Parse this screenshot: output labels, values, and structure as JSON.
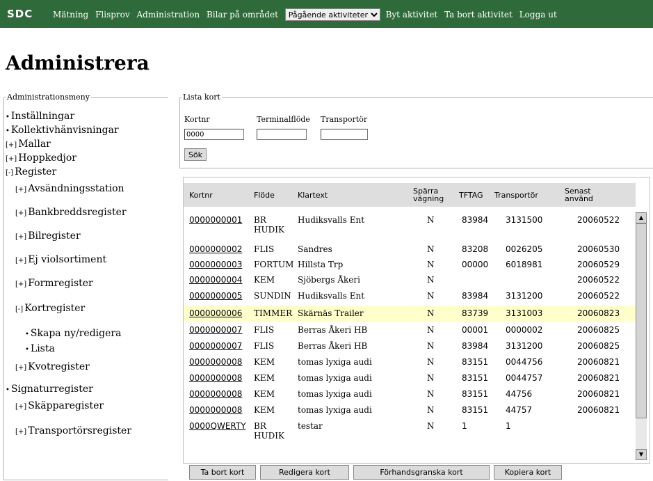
{
  "topbar": {
    "logo": "SDC",
    "nav": [
      "Mätning",
      "Flisprov",
      "Administration",
      "Bilar på området"
    ],
    "activity_select": "Pågående aktiviteter",
    "nav2": [
      "Byt aktivitet",
      "Ta bort aktivitet",
      "Logga ut"
    ]
  },
  "page_title": "Administrera",
  "menu": {
    "legend": "Administrationsmeny",
    "items": [
      {
        "marker": "•",
        "label": "Inställningar"
      },
      {
        "marker": "•",
        "label": "Kollektivhänvisningar"
      },
      {
        "marker": "[+]",
        "label": "Mallar"
      },
      {
        "marker": "[+]",
        "label": "Hoppkedjor"
      },
      {
        "marker": "[-]",
        "label": "Register"
      },
      {
        "marker": "[+]",
        "label": "Avsändningsstation"
      },
      {
        "marker": "[+]",
        "label": "Bankbreddsregister"
      },
      {
        "marker": "[+]",
        "label": "Bilregister"
      },
      {
        "marker": "[+]",
        "label": "Ej violsortiment"
      },
      {
        "marker": "[+]",
        "label": "Formregister"
      },
      {
        "marker": "[-]",
        "label": "Kortregister"
      },
      {
        "marker": "•",
        "label": "Skapa ny/redigera"
      },
      {
        "marker": "•",
        "label": "Lista"
      },
      {
        "marker": "[+]",
        "label": "Kvotregister"
      },
      {
        "marker": "•",
        "label": "Signaturregister"
      },
      {
        "marker": "[+]",
        "label": "Skäpparegister"
      },
      {
        "marker": "[+]",
        "label": "Transportörsregister"
      }
    ]
  },
  "search": {
    "legend": "Lista kort",
    "kortnr_label": "Kortnr",
    "kortnr_value": "0000",
    "terminal_label": "Terminalflöde",
    "terminal_value": "",
    "transportor_label": "Transportör",
    "transportor_value": "",
    "search_button": "Sök"
  },
  "table": {
    "headers": [
      "Kortnr",
      "Flöde",
      "Klartext",
      "Spärra vägning",
      "TFTAG",
      "Transportör",
      "Senast använd"
    ],
    "rows": [
      {
        "kortnr": "0000000001",
        "flode": "BR HUDIK",
        "klartext": "Hudiksvalls Ent",
        "sparra": "N",
        "tftag": "83984",
        "transportor": "3131500",
        "senast": "20060522"
      },
      {
        "kortnr": "0000000002",
        "flode": "FLIS",
        "klartext": "Sandres",
        "sparra": "N",
        "tftag": "83208",
        "transportor": "0026205",
        "senast": "20060530"
      },
      {
        "kortnr": "0000000003",
        "flode": "FORTUM",
        "klartext": "Hillsta Trp",
        "sparra": "N",
        "tftag": "00000",
        "transportor": "6018981",
        "senast": "20060529"
      },
      {
        "kortnr": "0000000004",
        "flode": "KEM",
        "klartext": "Sjöbergs Åkeri",
        "sparra": "N",
        "tftag": "",
        "transportor": "",
        "senast": "20060522"
      },
      {
        "kortnr": "0000000005",
        "flode": "SUNDIN",
        "klartext": "Hudiksvalls Ent",
        "sparra": "N",
        "tftag": "83984",
        "transportor": "3131200",
        "senast": "20060522"
      },
      {
        "kortnr": "0000000006",
        "flode": "TIMMER",
        "klartext": "Skärnäs Trailer",
        "sparra": "N",
        "tftag": "83739",
        "transportor": "3131003",
        "senast": "20060823"
      },
      {
        "kortnr": "0000000007",
        "flode": "FLIS",
        "klartext": "Berras Åkeri HB",
        "sparra": "N",
        "tftag": "00001",
        "transportor": "0000002",
        "senast": "20060825"
      },
      {
        "kortnr": "0000000007",
        "flode": "FLIS",
        "klartext": "Berras Åkeri HB",
        "sparra": "N",
        "tftag": "83984",
        "transportor": "3131200",
        "senast": "20060825"
      },
      {
        "kortnr": "0000000008",
        "flode": "KEM",
        "klartext": "tomas lyxiga audi",
        "sparra": "N",
        "tftag": "83151",
        "transportor": "0044756",
        "senast": "20060821"
      },
      {
        "kortnr": "0000000008",
        "flode": "KEM",
        "klartext": "tomas lyxiga audi",
        "sparra": "N",
        "tftag": "83151",
        "transportor": "0044757",
        "senast": "20060821"
      },
      {
        "kortnr": "0000000008",
        "flode": "KEM",
        "klartext": "tomas lyxiga audi",
        "sparra": "N",
        "tftag": "83151",
        "transportor": "44756",
        "senast": "20060821"
      },
      {
        "kortnr": "0000000008",
        "flode": "KEM",
        "klartext": "tomas lyxiga audi",
        "sparra": "N",
        "tftag": "83151",
        "transportor": "44757",
        "senast": "20060821"
      },
      {
        "kortnr": "0000QWERTY",
        "flode": "BR HUDIK",
        "klartext": "testar",
        "sparra": "N",
        "tftag": "1",
        "transportor": "1",
        "senast": ""
      }
    ],
    "highlight_row": 5
  },
  "buttons": {
    "delete": "Ta bort kort",
    "edit": "Redigera kort",
    "preview": "Förhandsgranska kort",
    "copy": "Kopiera kort"
  },
  "colors": {
    "topbar": "#2f6a3a",
    "header": "#dedede",
    "highlight": "#ffffcc"
  }
}
